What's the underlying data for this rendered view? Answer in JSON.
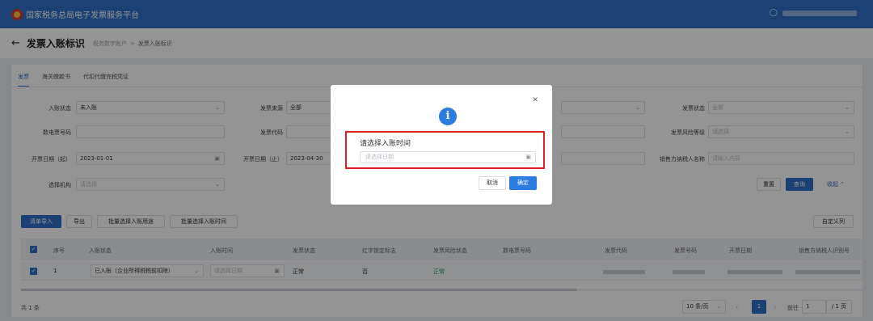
{
  "app": {
    "title": "国家税务总局电子发票服务平台"
  },
  "page": {
    "title": "发票入账标识",
    "breadcrumb": [
      "税务数字账户",
      "发票入账标识"
    ]
  },
  "tabs": [
    "发票",
    "海关缴款书",
    "代扣代缴完税凭证"
  ],
  "filters": {
    "ruzhang_status": {
      "label": "入账状态",
      "value": "未入账"
    },
    "fapiao_source": {
      "label": "发票来源",
      "value": "全部"
    },
    "fapiao_status": {
      "label": "发票状态",
      "value": "全部"
    },
    "shudian_number": {
      "label": "数电票号码",
      "value": ""
    },
    "fapiao_code": {
      "label": "发票代码",
      "value": ""
    },
    "risk_level": {
      "label": "发票风险等级",
      "placeholder": "请选择"
    },
    "date_start": {
      "label": "开票日期（起）",
      "value": "2023-01-01"
    },
    "date_end": {
      "label": "开票日期（止）",
      "value": "2023-04-30"
    },
    "seller_name": {
      "label": "销售方纳税人名称",
      "placeholder": "请输入内容"
    },
    "org": {
      "label": "选择机构",
      "placeholder": "请选择"
    },
    "reset_label": "重置",
    "query_label": "查询",
    "collapse_label": "收起"
  },
  "actions": {
    "list_import": "清单导入",
    "export": "导出",
    "batch_usage": "批量选择入账用途",
    "batch_time": "批量选择入账时间",
    "custom_columns": "自定义列"
  },
  "table": {
    "headers": [
      "序号",
      "入账状态",
      "入账时间",
      "发票状态",
      "红字锁定标志",
      "发票风险状态",
      "数电票号码",
      "发票代码",
      "发票号码",
      "开票日期",
      "销售方纳税人识别号"
    ],
    "row": {
      "index": "1",
      "ruzhang_status": "已入账（企业所得税税前扣除）",
      "ruzhang_time_placeholder": "请选择日期",
      "fapiao_status": "正常",
      "red_lock": "否",
      "risk_status": "正常"
    }
  },
  "footer": {
    "total": "共 1 条",
    "page_size": "10 条/页",
    "current_page": "1",
    "goto_label": "前往",
    "goto_value": "1",
    "page_total": "/ 1 页"
  },
  "modal": {
    "label": "请选择入账时间",
    "date_placeholder": "请选择日期",
    "cancel": "取消",
    "confirm": "确定"
  },
  "colors": {
    "primary": "#2d6fc8",
    "highlight": "#e02020",
    "success": "#1e9c5a"
  }
}
